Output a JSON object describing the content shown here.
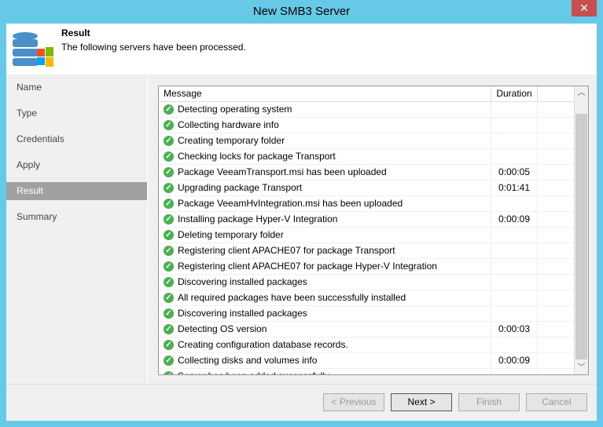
{
  "window": {
    "title": "New SMB3 Server",
    "close": "✕"
  },
  "header": {
    "title": "Result",
    "subtitle": "The following servers have been processed."
  },
  "nav": [
    "Name",
    "Type",
    "Credentials",
    "Apply",
    "Result",
    "Summary"
  ],
  "table": {
    "columns": [
      "Message",
      "Duration"
    ],
    "rows": [
      [
        "Detecting operating system",
        ""
      ],
      [
        "Collecting hardware info",
        ""
      ],
      [
        "Creating temporary folder",
        ""
      ],
      [
        "Checking locks for package Transport",
        ""
      ],
      [
        "Package VeeamTransport.msi has been uploaded",
        "0:00:05"
      ],
      [
        "Upgrading package Transport",
        "0:01:41"
      ],
      [
        "Package VeeamHvIntegration.msi has been uploaded",
        ""
      ],
      [
        "Installing package Hyper-V Integration",
        "0:00:09"
      ],
      [
        "Deleting temporary folder",
        ""
      ],
      [
        "Registering client APACHE07 for package Transport",
        ""
      ],
      [
        "Registering client APACHE07 for package Hyper-V Integration",
        ""
      ],
      [
        "Discovering installed packages",
        ""
      ],
      [
        "All required packages have been successfully installed",
        ""
      ],
      [
        "Discovering installed packages",
        ""
      ],
      [
        "Detecting OS version",
        "0:00:03"
      ],
      [
        "Creating configuration database records.",
        ""
      ],
      [
        "Collecting disks and volumes info",
        "0:00:09"
      ],
      [
        "Server has been added successfully",
        ""
      ]
    ]
  },
  "buttons": {
    "previous": "< Previous",
    "next": "Next >",
    "finish": "Finish",
    "cancel": "Cancel"
  }
}
